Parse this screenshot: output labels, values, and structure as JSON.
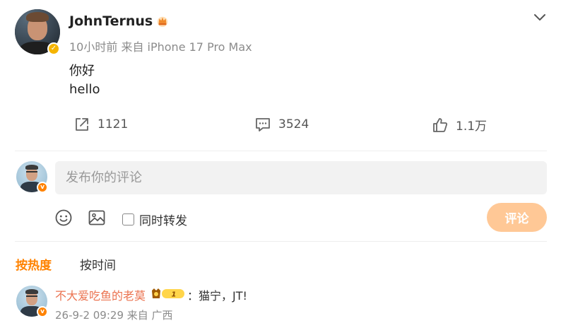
{
  "post": {
    "username": "JohnTernus",
    "meta": "10小时前  来自 iPhone 17 Pro Max",
    "line1": "你好",
    "line2": "hello",
    "actions": {
      "repost_count": "1121",
      "comment_count": "3524",
      "like_count": "1.1万"
    }
  },
  "composer": {
    "placeholder": "发布你的评论",
    "repost_label": "同时转发",
    "submit_label": "评论",
    "emoji_icon": "smile-icon",
    "image_icon": "image-icon"
  },
  "sort": {
    "hot_label": "按热度",
    "time_label": "按时间"
  },
  "comments": [
    {
      "author": "不大爱吃鱼的老莫",
      "badge_level": "1",
      "text": "：猫宁，JT!",
      "meta": "26-9-2 09:29 来自 广西"
    }
  ],
  "colors": {
    "accent_orange": "#ff8200",
    "username_link": "#eb7350",
    "submit_disabled": "#ffc896",
    "verified_gold": "#f5b400"
  }
}
